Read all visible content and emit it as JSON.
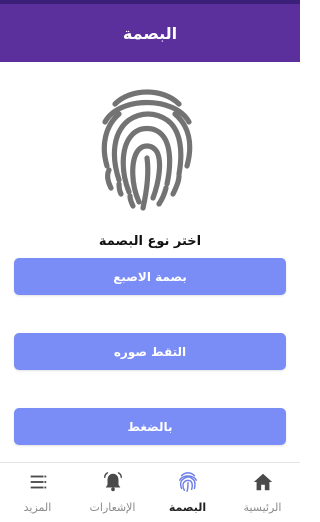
{
  "header": {
    "title": "البصمة"
  },
  "main": {
    "prompt": "اختر نوع البصمة",
    "buttons": [
      {
        "label": "بصمة الاصبع"
      },
      {
        "label": "التقط صوره"
      },
      {
        "label": "بالضغط"
      }
    ]
  },
  "bottom_nav": {
    "items": [
      {
        "label": "الرئيسية",
        "icon": "home-icon",
        "active": false
      },
      {
        "label": "البصمة",
        "icon": "fingerprint-icon",
        "active": true
      },
      {
        "label": "الإشعارات",
        "icon": "bell-icon",
        "active": false
      },
      {
        "label": "المزيد",
        "icon": "menu-icon",
        "active": false
      }
    ]
  },
  "colors": {
    "header": "#5b2f9c",
    "button": "#7a8cf5",
    "fingerprint": "#737373"
  }
}
